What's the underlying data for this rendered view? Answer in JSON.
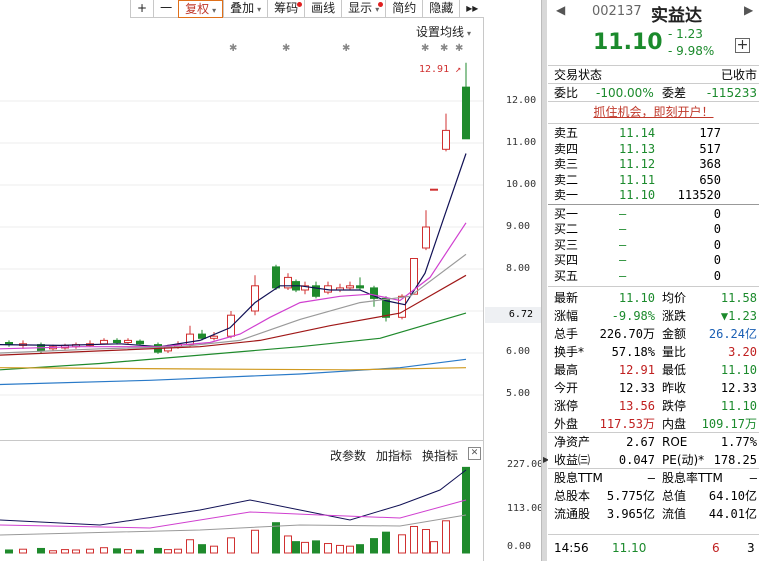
{
  "toolbar": {
    "items": [
      {
        "label": "+",
        "caret": false,
        "dot": false
      },
      {
        "label": "一",
        "caret": false,
        "dot": false
      },
      {
        "label": "复权",
        "caret": true,
        "dot": false,
        "active": true
      },
      {
        "label": "叠加",
        "caret": true,
        "dot": false
      },
      {
        "label": "筹码",
        "caret": false,
        "dot": true
      },
      {
        "label": "画线",
        "caret": false,
        "dot": false
      },
      {
        "label": "显示",
        "caret": true,
        "dot": true
      },
      {
        "label": "简约",
        "caret": false,
        "dot": false
      },
      {
        "label": "隐藏",
        "caret": false,
        "dot": false
      }
    ],
    "more_glyph": "▸▸"
  },
  "chart": {
    "ma_settings_label": "设置均线",
    "high_label": "12.91",
    "current_price_label": "6.72",
    "y_ticks": [
      "12.00",
      "11.00",
      "10.00",
      "9.00",
      "8.00",
      "6.00",
      "5.00"
    ],
    "volume_ticks": [
      "227.00",
      "113.00",
      "0.00"
    ],
    "indicator_bar": [
      "改参数",
      "加指标",
      "换指标"
    ],
    "close_glyph": "✕",
    "colors": {
      "up": "#d03030",
      "down": "#1f8a2c",
      "ma5": "#111155",
      "ma10": "#d040d0",
      "ma20": "#9a9a9a",
      "ma30": "#a01818",
      "ma60": "#1f8a2c",
      "ma120": "#2a7ac8",
      "ma250": "#d09a20"
    }
  },
  "panel": {
    "nav_prev": "◀",
    "nav_next": "▶",
    "code": "002137",
    "name": "实益达",
    "price": "11.10",
    "change": "- 1.23",
    "change_pct": "- 9.98%",
    "add_glyph": "+",
    "status_label": "交易状态",
    "status_value": "已收市",
    "weibi_label": "委比",
    "weibi_value": "-100.00%",
    "weicha_label": "委差",
    "weicha_value": "-115233",
    "promo": "抓住机会，即刻开户！",
    "sell_levels": [
      {
        "label": "卖五",
        "price": "11.14",
        "vol": "177"
      },
      {
        "label": "卖四",
        "price": "11.13",
        "vol": "517"
      },
      {
        "label": "卖三",
        "price": "11.12",
        "vol": "368"
      },
      {
        "label": "卖二",
        "price": "11.11",
        "vol": "650"
      },
      {
        "label": "卖一",
        "price": "11.10",
        "vol": "113520"
      }
    ],
    "buy_levels": [
      {
        "label": "买一",
        "price": "—",
        "vol": "0"
      },
      {
        "label": "买二",
        "price": "—",
        "vol": "0"
      },
      {
        "label": "买三",
        "price": "—",
        "vol": "0"
      },
      {
        "label": "买四",
        "price": "—",
        "vol": "0"
      },
      {
        "label": "买五",
        "price": "—",
        "vol": "0"
      }
    ],
    "quotes": [
      {
        "k1": "最新",
        "v1": "11.10",
        "c1": "g",
        "k2": "均价",
        "v2": "11.58",
        "c2": "g"
      },
      {
        "k1": "涨幅",
        "v1": "-9.98%",
        "c1": "g",
        "k2": "涨跌",
        "v2": "▼1.23",
        "c2": "g"
      },
      {
        "k1": "总手",
        "v1": "226.70万",
        "c1": "",
        "k2": "金额",
        "v2": "26.24亿",
        "c2": "bl"
      },
      {
        "k1": "换手*",
        "v1": "57.18%",
        "c1": "",
        "k2": "量比",
        "v2": "3.20",
        "c2": "rd"
      },
      {
        "k1": "最高",
        "v1": "12.91",
        "c1": "rd",
        "k2": "最低",
        "v2": "11.10",
        "c2": "g"
      },
      {
        "k1": "今开",
        "v1": "12.33",
        "c1": "",
        "k2": "昨收",
        "v2": "12.33",
        "c2": ""
      },
      {
        "k1": "涨停",
        "v1": "13.56",
        "c1": "rd",
        "k2": "跌停",
        "v2": "11.10",
        "c2": "g"
      },
      {
        "k1": "外盘",
        "v1": "117.53万",
        "c1": "rd",
        "k2": "内盘",
        "v2": "109.17万",
        "c2": "g"
      },
      {
        "k1": "净资产",
        "v1": "2.67",
        "c1": "",
        "k2": "ROE",
        "v2": "1.77%",
        "c2": ""
      },
      {
        "k1": "收益㈢",
        "v1": "0.047",
        "c1": "",
        "k2": "PE(动)*",
        "v2": "178.25",
        "c2": ""
      },
      {
        "k1": "股息TTM",
        "v1": "—",
        "c1": "",
        "k2": "股息率TTM",
        "v2": "—",
        "c2": ""
      },
      {
        "k1": "总股本",
        "v1": "5.775亿",
        "c1": "",
        "k2": "总值",
        "v2": "64.10亿",
        "c2": ""
      },
      {
        "k1": "流通股",
        "v1": "3.965亿",
        "c1": "",
        "k2": "流值",
        "v2": "44.01亿",
        "c2": ""
      }
    ],
    "tick": {
      "time": "14:56",
      "price": "11.10",
      "vol": "6",
      "count": "3"
    }
  }
}
